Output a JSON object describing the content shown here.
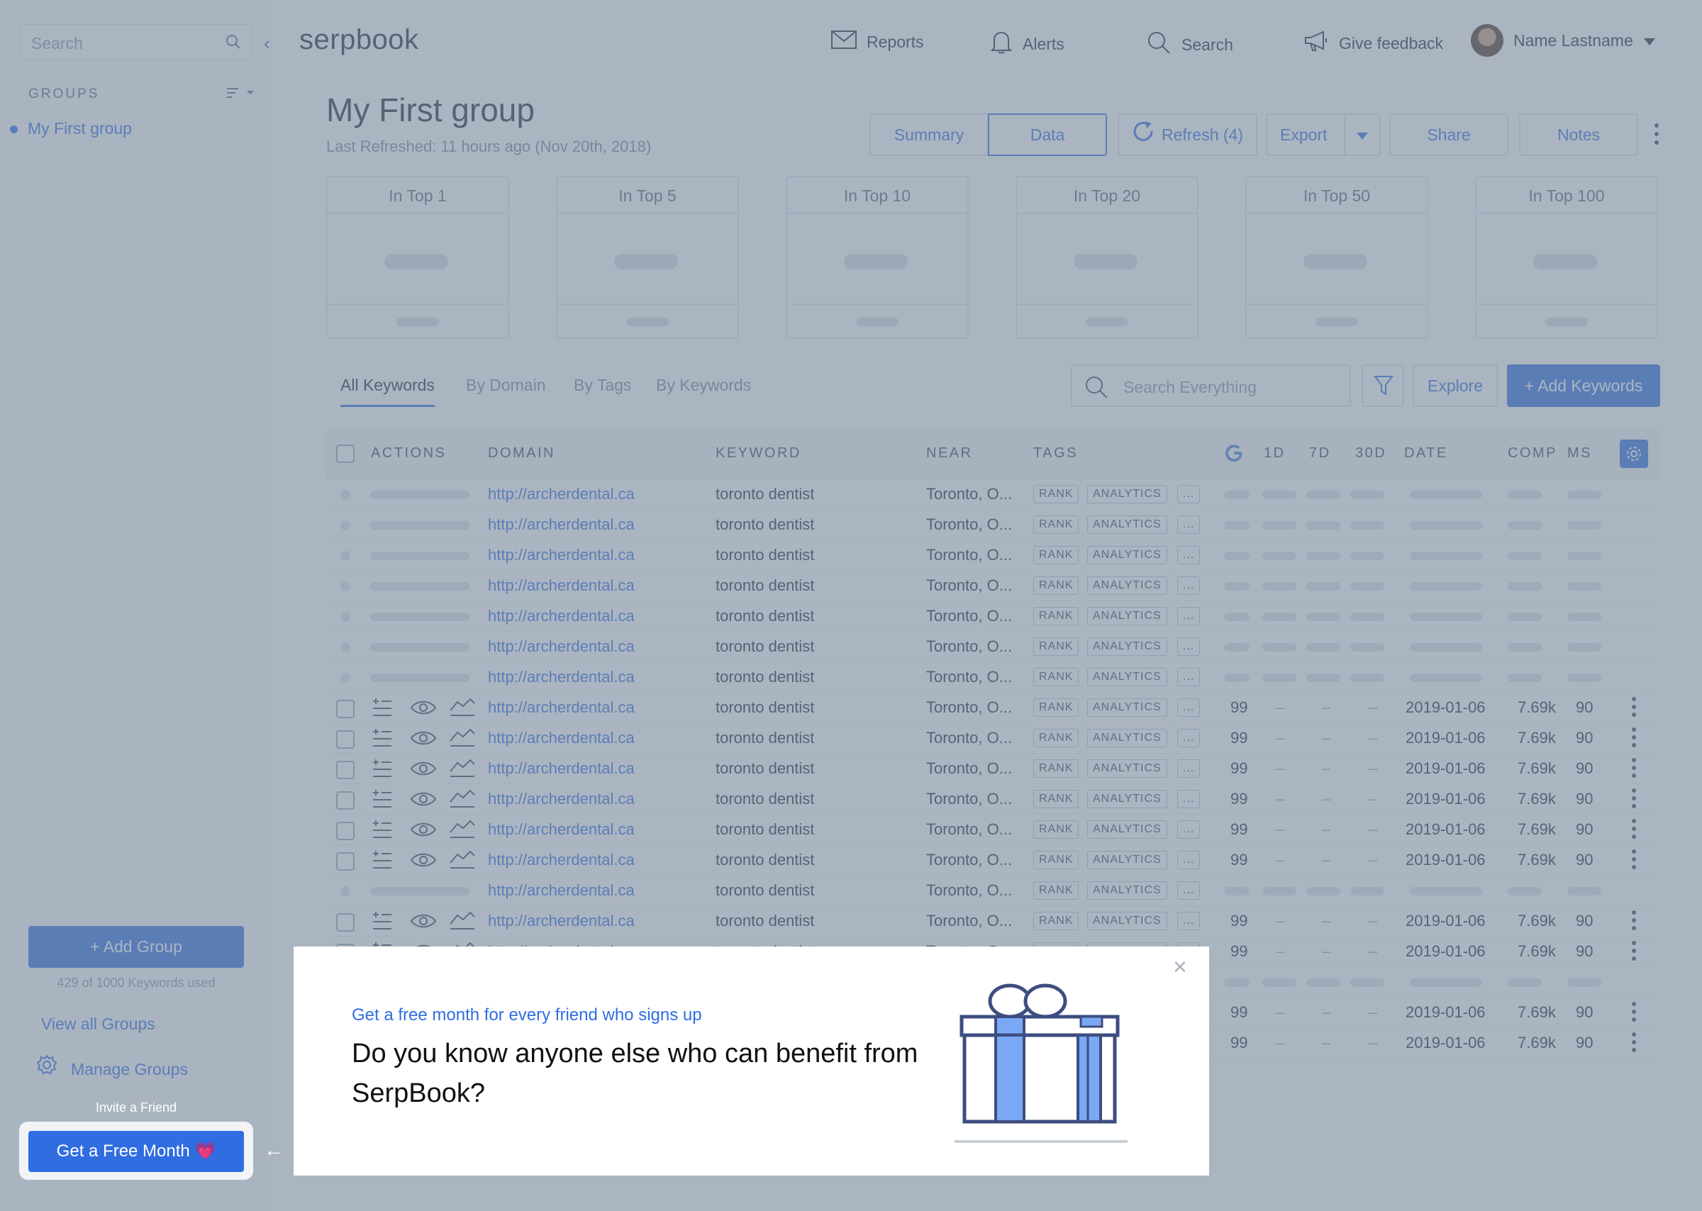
{
  "sidebar": {
    "search_placeholder": "Search",
    "groups_heading": "GROUPS",
    "groups": [
      "My First group"
    ],
    "add_group": "+ Add Group",
    "keywords_used": "429 of 1000 Keywords used",
    "view_all_groups": "View all Groups",
    "manage_groups": "Manage Groups",
    "invite_label": "Invite a Friend",
    "free_month": "Get a Free Month",
    "free_month_emoji": "💗"
  },
  "header": {
    "logo": "serpbook",
    "nav": {
      "reports": "Reports",
      "alerts": "Alerts",
      "search": "Search",
      "feedback": "Give feedback",
      "user": "Name Lastname"
    }
  },
  "page": {
    "title": "My First group",
    "last_refreshed": "Last Refreshed: 11 hours ago (Nov 20th, 2018)",
    "buttons": {
      "summary": "Summary",
      "data": "Data",
      "refresh": "Refresh (4)",
      "export": "Export",
      "share": "Share",
      "notes": "Notes"
    }
  },
  "cards": [
    "In Top 1",
    "In Top 5",
    "In Top 10",
    "In Top 20",
    "In Top 50",
    "In Top 100"
  ],
  "tabs": [
    "All Keywords",
    "By Domain",
    "By Tags",
    "By Keywords"
  ],
  "search_everything_placeholder": "Search Everything",
  "explore": "Explore",
  "add_keywords": "+ Add Keywords",
  "table": {
    "headers": {
      "actions": "ACTIONS",
      "domain": "DOMAIN",
      "keyword": "KEYWORD",
      "near": "NEAR",
      "tags": "TAGS",
      "d1": "1D",
      "d7": "7D",
      "d30": "30D",
      "date": "DATE",
      "comp": "COMP",
      "ms": "MS"
    },
    "row_values": {
      "domain": "http://archerdental.ca",
      "keyword": "toronto dentist",
      "near": "Toronto, O...",
      "tag1": "RANK",
      "tag2": "ANALYTICS",
      "tag_more": "...",
      "g": "99",
      "dash": "–",
      "date": "2019-01-06",
      "comp": "7.69k",
      "ms": "90"
    }
  },
  "popup": {
    "subtitle": "Get a free month for every friend who signs up",
    "title": "Do you know anyone else who can benefit from SerpBook?"
  },
  "colors": {
    "accent": "#2f6de1",
    "overlay": "#78889b",
    "gift_blue": "#7aa8f5",
    "gift_outline": "#3d4d80"
  }
}
